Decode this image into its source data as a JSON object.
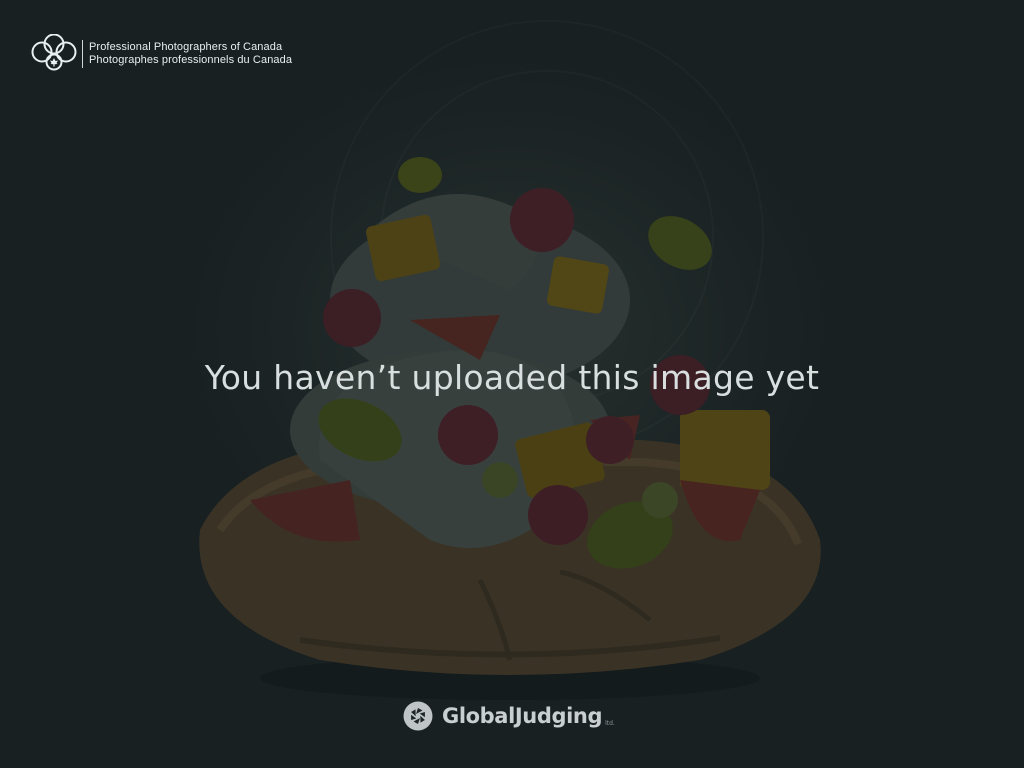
{
  "header": {
    "org_name_en": "Professional Photographers of Canada",
    "org_name_fr": "Photographes professionnels du Canada"
  },
  "main": {
    "message": "You haven’t uploaded this image yet"
  },
  "footer": {
    "brand_name": "GlobalJudging",
    "brand_mark": "ltd."
  },
  "icons": {
    "logo": "ppoc-logo-icon",
    "footer": "aperture-icon"
  },
  "colors": {
    "background": "#1a2225",
    "text": "#d9dedf"
  }
}
